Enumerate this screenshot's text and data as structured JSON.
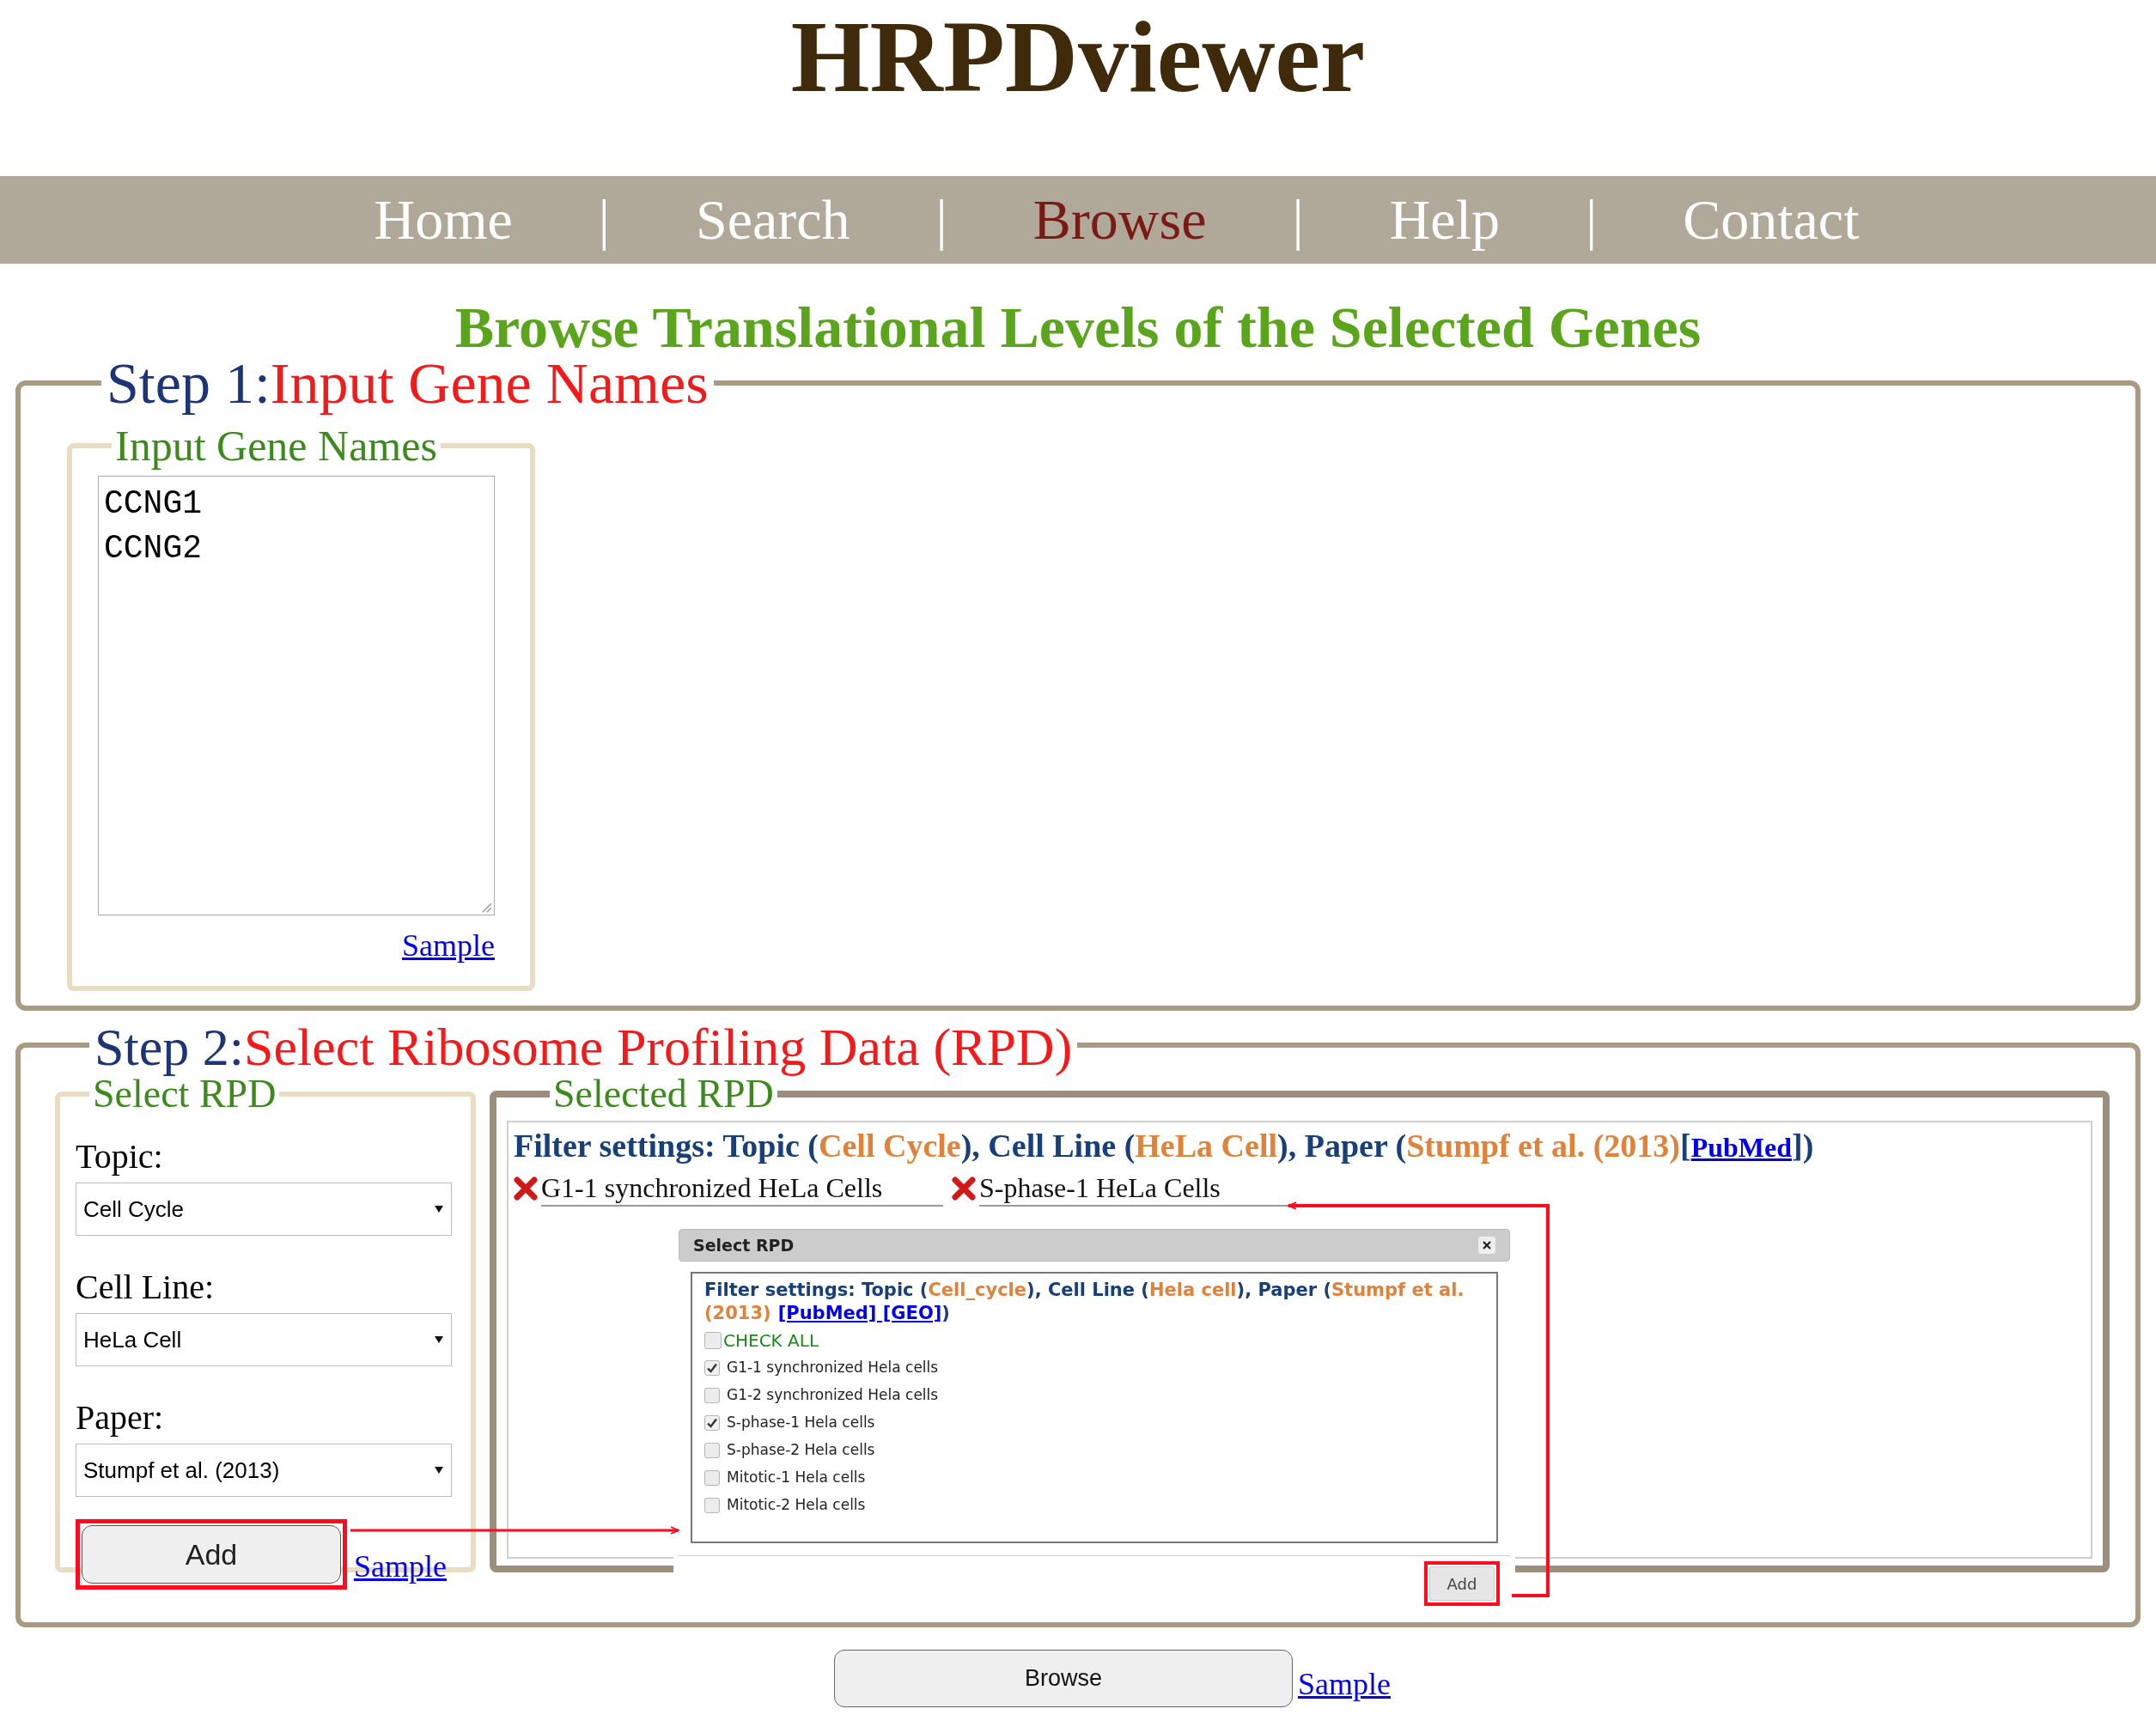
{
  "title": "HRPDviewer",
  "nav": [
    {
      "kind": "link",
      "label": "Home",
      "selected": false
    },
    {
      "kind": "separator",
      "label": "|"
    },
    {
      "kind": "link",
      "label": "Search",
      "selected": false
    },
    {
      "kind": "separator",
      "label": "|"
    },
    {
      "kind": "link",
      "label": "Browse",
      "selected": true
    },
    {
      "kind": "separator",
      "label": "|"
    },
    {
      "kind": "link",
      "label": "Help",
      "selected": false
    },
    {
      "kind": "separator",
      "label": "|"
    },
    {
      "kind": "link",
      "label": "Contact",
      "selected": false
    }
  ],
  "heading": "Browse Translational Levels of the Selected Genes",
  "step1": {
    "step": "Step 1:",
    "title": "Input Gene Names",
    "gene_box": {
      "legend": "Input Gene Names",
      "value": "CCNG1\nCCNG2",
      "sample_link": "Sample"
    }
  },
  "step2": {
    "step": "Step 2:",
    "title": "Select Ribosome Profiling Data (RPD)",
    "select_panel": {
      "legend": "Select RPD",
      "fields": [
        {
          "label": "Topic:",
          "value": "Cell Cycle"
        },
        {
          "label": "Cell Line:",
          "value": "HeLa Cell"
        },
        {
          "label": "Paper:",
          "value": "Stumpf et al. (2013)"
        }
      ],
      "add_button": "Add",
      "sample_link": "Sample"
    },
    "selected_panel": {
      "legend": "Selected RPD",
      "filter": [
        {
          "kind": "plain",
          "text": "Filter settings: Topic ("
        },
        {
          "kind": "value",
          "text": "Cell Cycle"
        },
        {
          "kind": "plain",
          "text": "), Cell Line ("
        },
        {
          "kind": "value",
          "text": "HeLa Cell"
        },
        {
          "kind": "plain",
          "text": "), Paper ("
        },
        {
          "kind": "value",
          "text": "Stumpf et al. (2013)"
        },
        {
          "kind": "plain",
          "text": "["
        },
        {
          "kind": "link",
          "text": "PubMed"
        },
        {
          "kind": "plain",
          "text": "])"
        }
      ],
      "chips": [
        {
          "label": "G1-1 synchronized HeLa Cells"
        },
        {
          "label": "S-phase-1 HeLa Cells"
        }
      ],
      "dialog": {
        "title": "Select RPD",
        "filter": [
          {
            "kind": "plain",
            "text": "Filter settings: Topic ("
          },
          {
            "kind": "value",
            "text": "Cell_cycle"
          },
          {
            "kind": "plain",
            "text": "), Cell Line ("
          },
          {
            "kind": "value",
            "text": "Hela cell"
          },
          {
            "kind": "plain",
            "text": "), Paper ("
          },
          {
            "kind": "value",
            "text": "Stumpf et al. (2013)"
          },
          {
            "kind": "link",
            "text": "[PubMed] [GEO]"
          },
          {
            "kind": "plain",
            "text": ")"
          }
        ],
        "check_all": {
          "label": "CHECK ALL",
          "checked": false
        },
        "options": [
          {
            "label": "G1-1 synchronized Hela cells",
            "checked": true
          },
          {
            "label": "G1-2 synchronized Hela cells",
            "checked": false
          },
          {
            "label": "S-phase-1 Hela cells",
            "checked": true
          },
          {
            "label": "S-phase-2 Hela cells",
            "checked": false
          },
          {
            "label": "Mitotic-1 Hela cells",
            "checked": false
          },
          {
            "label": "Mitotic-2 Hela cells",
            "checked": false
          }
        ],
        "add_button": "Add"
      }
    }
  },
  "browse_button": "Browse",
  "browse_sample_link": "Sample"
}
